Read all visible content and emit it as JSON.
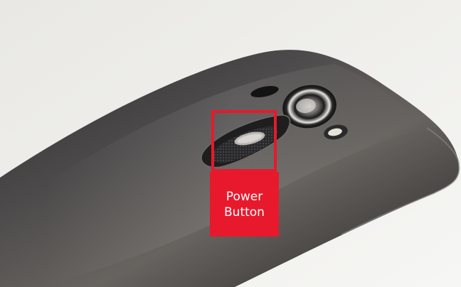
{
  "annotation": {
    "label_line1": "Power",
    "label_line2": "Button",
    "color": "#e8192c",
    "text_color": "#ffffff"
  },
  "photo": {
    "background_color": "#eeedea",
    "phone_body_color": "#4a4748"
  }
}
